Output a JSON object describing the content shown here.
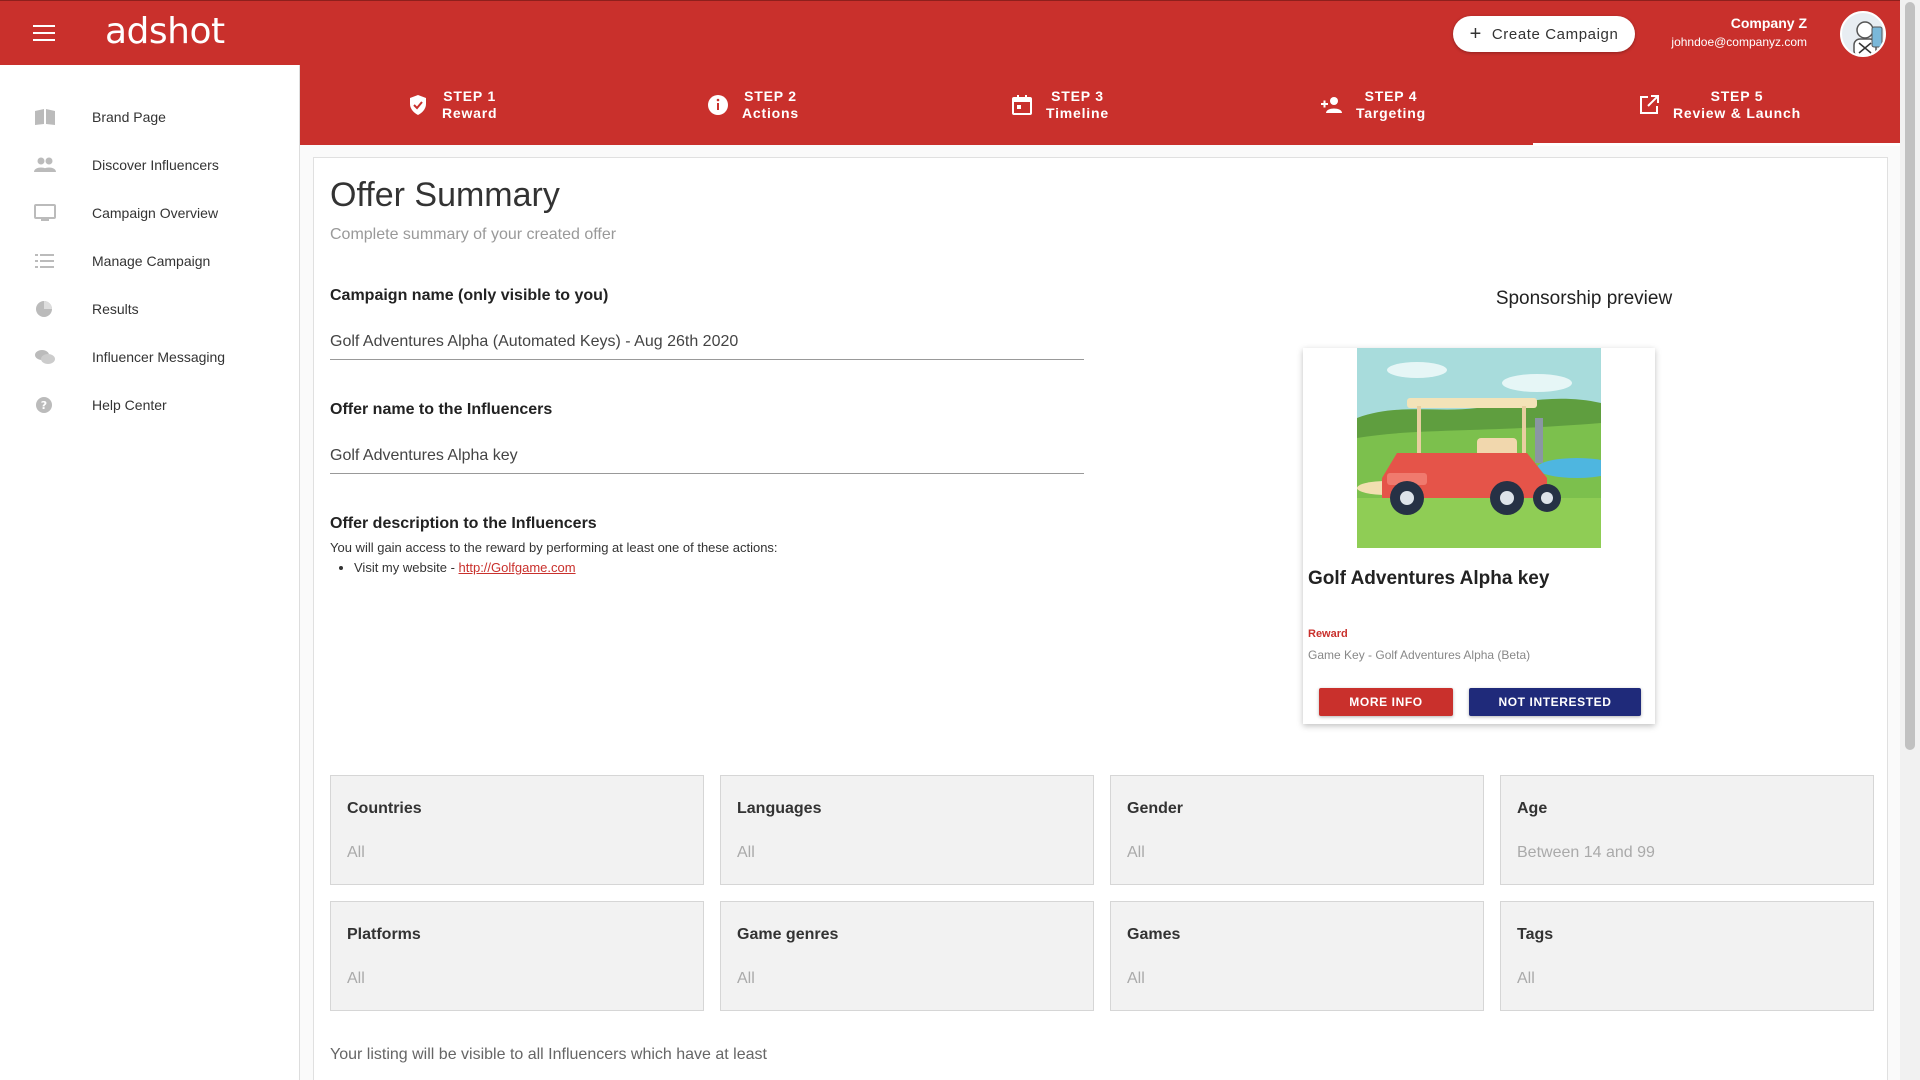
{
  "app": {
    "logo": "adshot",
    "create_campaign": "Create Campaign"
  },
  "user": {
    "company": "Company Z",
    "email": "johndoe@companyz.com"
  },
  "sidebar": {
    "items": [
      {
        "label": "Brand Page",
        "icon": "book-icon"
      },
      {
        "label": "Discover Influencers",
        "icon": "people-icon"
      },
      {
        "label": "Campaign Overview",
        "icon": "monitor-icon"
      },
      {
        "label": "Manage Campaign",
        "icon": "checklist-icon"
      },
      {
        "label": "Results",
        "icon": "pie-chart-icon"
      },
      {
        "label": "Influencer Messaging",
        "icon": "chat-icon"
      },
      {
        "label": "Help Center",
        "icon": "help-icon"
      }
    ]
  },
  "steps": [
    {
      "step": "STEP 1",
      "name": "Reward",
      "icon": "shield-check-icon"
    },
    {
      "step": "STEP 2",
      "name": "Actions",
      "icon": "info-icon"
    },
    {
      "step": "STEP 3",
      "name": "Timeline",
      "icon": "calendar-icon"
    },
    {
      "step": "STEP 4",
      "name": "Targeting",
      "icon": "person-add-icon"
    },
    {
      "step": "STEP 5",
      "name": "Review & Launch",
      "icon": "open-in-new-icon"
    }
  ],
  "active_step": 5,
  "summary": {
    "title": "Offer Summary",
    "subtitle": "Complete summary of your created offer",
    "campaign_name_label": "Campaign name (only visible to you)",
    "campaign_name": "Golf Adventures Alpha (Automated Keys) - Aug 26th 2020",
    "offer_name_label": "Offer name to the Influencers",
    "offer_name": "Golf Adventures Alpha key",
    "description_label": "Offer description to the Influencers",
    "description_text": "You will gain access to the reward by performing at least one of these actions:",
    "description_item_prefix": "Visit my website - ",
    "description_item_link": "http://Golfgame.com"
  },
  "preview": {
    "title": "Sponsorship preview",
    "offer_name": "Golf Adventures Alpha key",
    "reward_label": "Reward",
    "reward_value": "Game Key - Golf Adventures Alpha (Beta)",
    "more_info": "MORE INFO",
    "not_interested": "NOT INTERESTED"
  },
  "targeting": [
    {
      "label": "Countries",
      "value": "All"
    },
    {
      "label": "Languages",
      "value": "All"
    },
    {
      "label": "Gender",
      "value": "All"
    },
    {
      "label": "Age",
      "value": "Between 14 and 99"
    },
    {
      "label": "Platforms",
      "value": "All"
    },
    {
      "label": "Game genres",
      "value": "All"
    },
    {
      "label": "Games",
      "value": "All"
    },
    {
      "label": "Tags",
      "value": "All"
    }
  ],
  "footer_text": "Your listing will be visible to all Influencers which have at least",
  "colors": {
    "primary": "#c9302c",
    "secondary": "#1f2a7a"
  }
}
